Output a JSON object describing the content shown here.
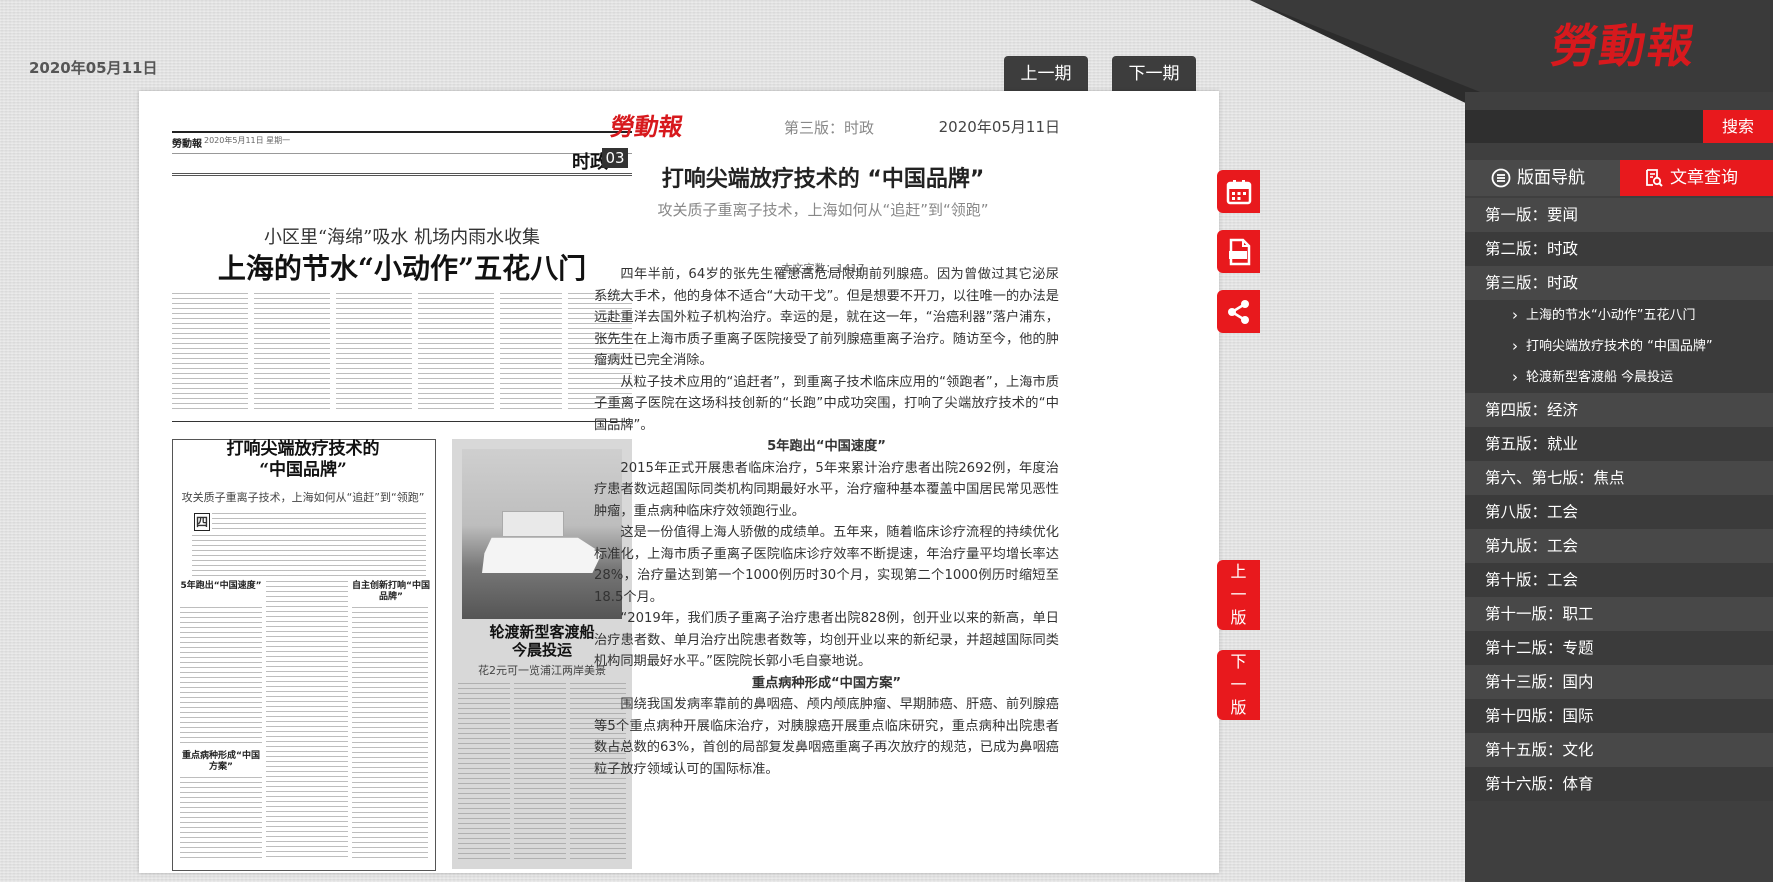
{
  "header": {
    "date": "2020年05月11日",
    "logo": "勞動報",
    "prev_issue_label": "上一期",
    "next_issue_label": "下一期"
  },
  "thumbnail": {
    "masthead_mini": "勞動報",
    "masthead_date": "2020年5月11日 星期一",
    "section_label": "时政",
    "section_num": "03",
    "top_subtitle": "小区里“海绵”吸水  机场内雨水收集",
    "top_title": "上海的节水“小动作”五花八门",
    "box_title_line1": "打响尖端放疗技术的",
    "box_title_line2": "“中国品牌”",
    "box_subtitle": "攻关质子重离子技术，上海如何从“追赶”到“领跑”",
    "drop_cap": "四",
    "mini_heads": [
      "5年跑出“中国速度”",
      "自主创新打响“中国品牌”",
      "重点病种形成“中国方案”"
    ],
    "ferry_title_line1": "轮渡新型客渡船",
    "ferry_title_line2": "今晨投运",
    "ferry_subtitle": "花2元可一览浦江两岸美景"
  },
  "article": {
    "logo": "勞動報",
    "section": "第三版：时政",
    "date": "2020年05月11日",
    "title": "打响尖端放疗技术的 “中国品牌”",
    "subtitle": "攻关质子重离子技术，上海如何从“追赶”到“领跑”",
    "word_count": "本文字数：1417",
    "paragraphs": [
      "四年半前，64岁的张先生罹患高危局限期前列腺癌。因为曾做过其它泌尿系统大手术，他的身体不适合“大动干戈”。但是想要不开刀，以往唯一的办法是远赴重洋去国外粒子机构治疗。幸运的是，就在这一年，“治癌利器”落户浦东，张先生在上海市质子重离子医院接受了前列腺癌重离子治疗。随访至今，他的肿瘤病灶已完全消除。",
      "从粒子技术应用的“追赶者”，到重离子技术临床应用的“领跑者”，上海市质子重离子医院在这场科技创新的“长跑”中成功突围，打响了尖端放疗技术的“中国品牌”。"
    ],
    "heading1": "5年跑出“中国速度”",
    "paragraphs2": [
      "2015年正式开展患者临床治疗，5年来累计治疗患者出院2692例，年度治疗患者数远超国际同类机构同期最好水平，治疗瘤种基本覆盖中国居民常见恶性肿瘤，重点病种临床疗效领跑行业。",
      "这是一份值得上海人骄傲的成绩单。五年来，随着临床诊疗流程的持续优化标准化，上海市质子重离子医院临床诊疗效率不断提速，年治疗量平均增长率达28%，治疗量达到第一个1000例历时30个月，实现第二个1000例历时缩短至18.5个月。",
      "“2019年，我们质子重离子治疗患者出院828例，创开业以来的新高，单日治疗患者数、单月治疗出院患者数等，均创开业以来的新纪录，并超越国际同类机构同期最好水平。”医院院长郭小毛自豪地说。"
    ],
    "heading2": "重点病种形成“中国方案”",
    "paragraphs3": [
      "围绕我国发病率靠前的鼻咽癌、颅内颅底肿瘤、早期肺癌、肝癌、前列腺癌等5个重点病种开展临床治疗，对胰腺癌开展重点临床研究，重点病种出院患者数占总数的63%，首创的局部复发鼻咽癌重离子再次放疗的规范，已成为鼻咽癌粒子放疗领域认可的国际标准。"
    ]
  },
  "tools": {
    "calendar_icon": "calendar-icon",
    "pdf_icon": "pdf-icon",
    "share_icon": "share-icon",
    "prev_page": [
      "上",
      "一",
      "版"
    ],
    "next_page": [
      "下",
      "一",
      "版"
    ]
  },
  "sidebar": {
    "search_label": "搜索",
    "tab_nav": "版面导航",
    "tab_query": "文章查询",
    "items": [
      {
        "label": "第一版：要闻"
      },
      {
        "label": "第二版：时政"
      },
      {
        "label": "第三版：时政"
      },
      {
        "label": "第四版：经济"
      },
      {
        "label": "第五版：就业"
      },
      {
        "label": "第六、第七版：焦点"
      },
      {
        "label": "第八版：工会"
      },
      {
        "label": "第九版：工会"
      },
      {
        "label": "第十版：工会"
      },
      {
        "label": "第十一版：职工"
      },
      {
        "label": "第十二版：专题"
      },
      {
        "label": "第十三版：国内"
      },
      {
        "label": "第十四版：国际"
      },
      {
        "label": "第十五版：文化"
      },
      {
        "label": "第十六版：体育"
      }
    ],
    "sub_items": [
      {
        "label": "上海的节水“小动作”五花八门"
      },
      {
        "label": "打响尖端放疗技术的 “中国品牌”"
      },
      {
        "label": "轮渡新型客渡船 今晨投运"
      }
    ]
  },
  "colors": {
    "accent_red": "#e8191d",
    "sidebar_dark": "#3f3f3f"
  }
}
